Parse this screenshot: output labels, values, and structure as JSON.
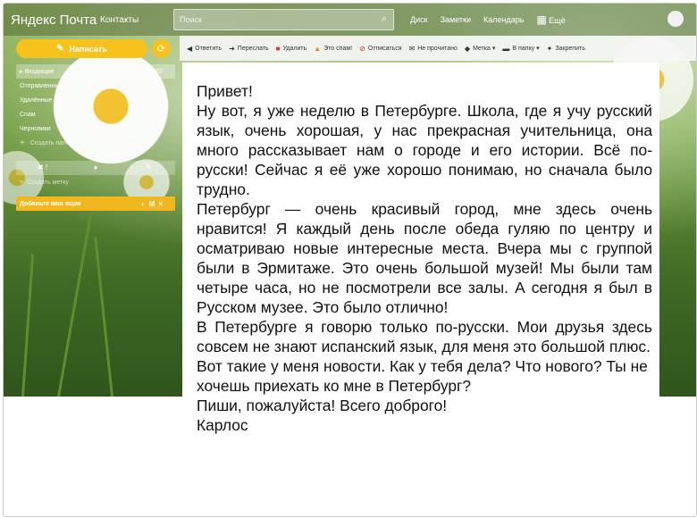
{
  "header": {
    "logo": "Яндекс Почта",
    "contacts": "Контакты",
    "search_placeholder": "Поиск",
    "links": [
      "Диск",
      "Заметки",
      "Календарь",
      "Ещё"
    ]
  },
  "sidebar": {
    "compose_label": "Написать",
    "folders": [
      {
        "label": "Входящие",
        "count": "1962"
      },
      {
        "label": "Отправленные",
        "count": ""
      },
      {
        "label": "Удалённые",
        "count": ""
      },
      {
        "label": "Спам",
        "count": ""
      },
      {
        "label": "Черновики",
        "count": ""
      }
    ],
    "create_folder": "Создать папку",
    "create_filter": "Создать метку",
    "add_mailbox": "Добавьте ваш ящик"
  },
  "toolbar": {
    "items": [
      {
        "label": "Ответить",
        "icon": "reply-icon"
      },
      {
        "label": "Переслать",
        "icon": "forward-icon"
      },
      {
        "label": "Удалить",
        "icon": "trash-icon"
      },
      {
        "label": "Это спам!",
        "icon": "spam-icon"
      },
      {
        "label": "Отписаться",
        "icon": "unsubscribe-icon"
      },
      {
        "label": "Не прочитано",
        "icon": "unread-icon"
      },
      {
        "label": "Метка ▾",
        "icon": "tag-icon"
      },
      {
        "label": "В папку ▾",
        "icon": "folder-icon"
      },
      {
        "label": "Закрепить",
        "icon": "pin-icon"
      }
    ]
  },
  "letter": {
    "paragraphs": [
      "Привет!",
      "Ну вот, я уже неделю в Петербурге. Школа, где я учу русский язык, очень хорошая, у нас прекрасная учительница, она много рассказывает нам о городе и его истории. Всё по-русски! Сейчас я её уже хорошо понимаю, но сначала было трудно.",
      "Петербург — очень красивый город, мне здесь очень нравится! Я каждый день после обеда гуляю по центру и осматриваю новые интересные места. Вчера мы с группой были в Эрмитаже. Это очень большой музей! Мы были там четыре часа, но не посмотрели все залы. А сегодня я был в Русском музее. Это было отлично!",
      "В Петербурге я говорю только по-русски. Мои друзья здесь совсем не знают испанский язык, для меня это большой плюс.",
      "Вот такие у меня новости. Как у тебя дела? Что нового? Ты не хочешь приехать ко мне в Петербург?",
      "Пиши, пожалуйста! Всего доброго!",
      "Карлос"
    ]
  }
}
